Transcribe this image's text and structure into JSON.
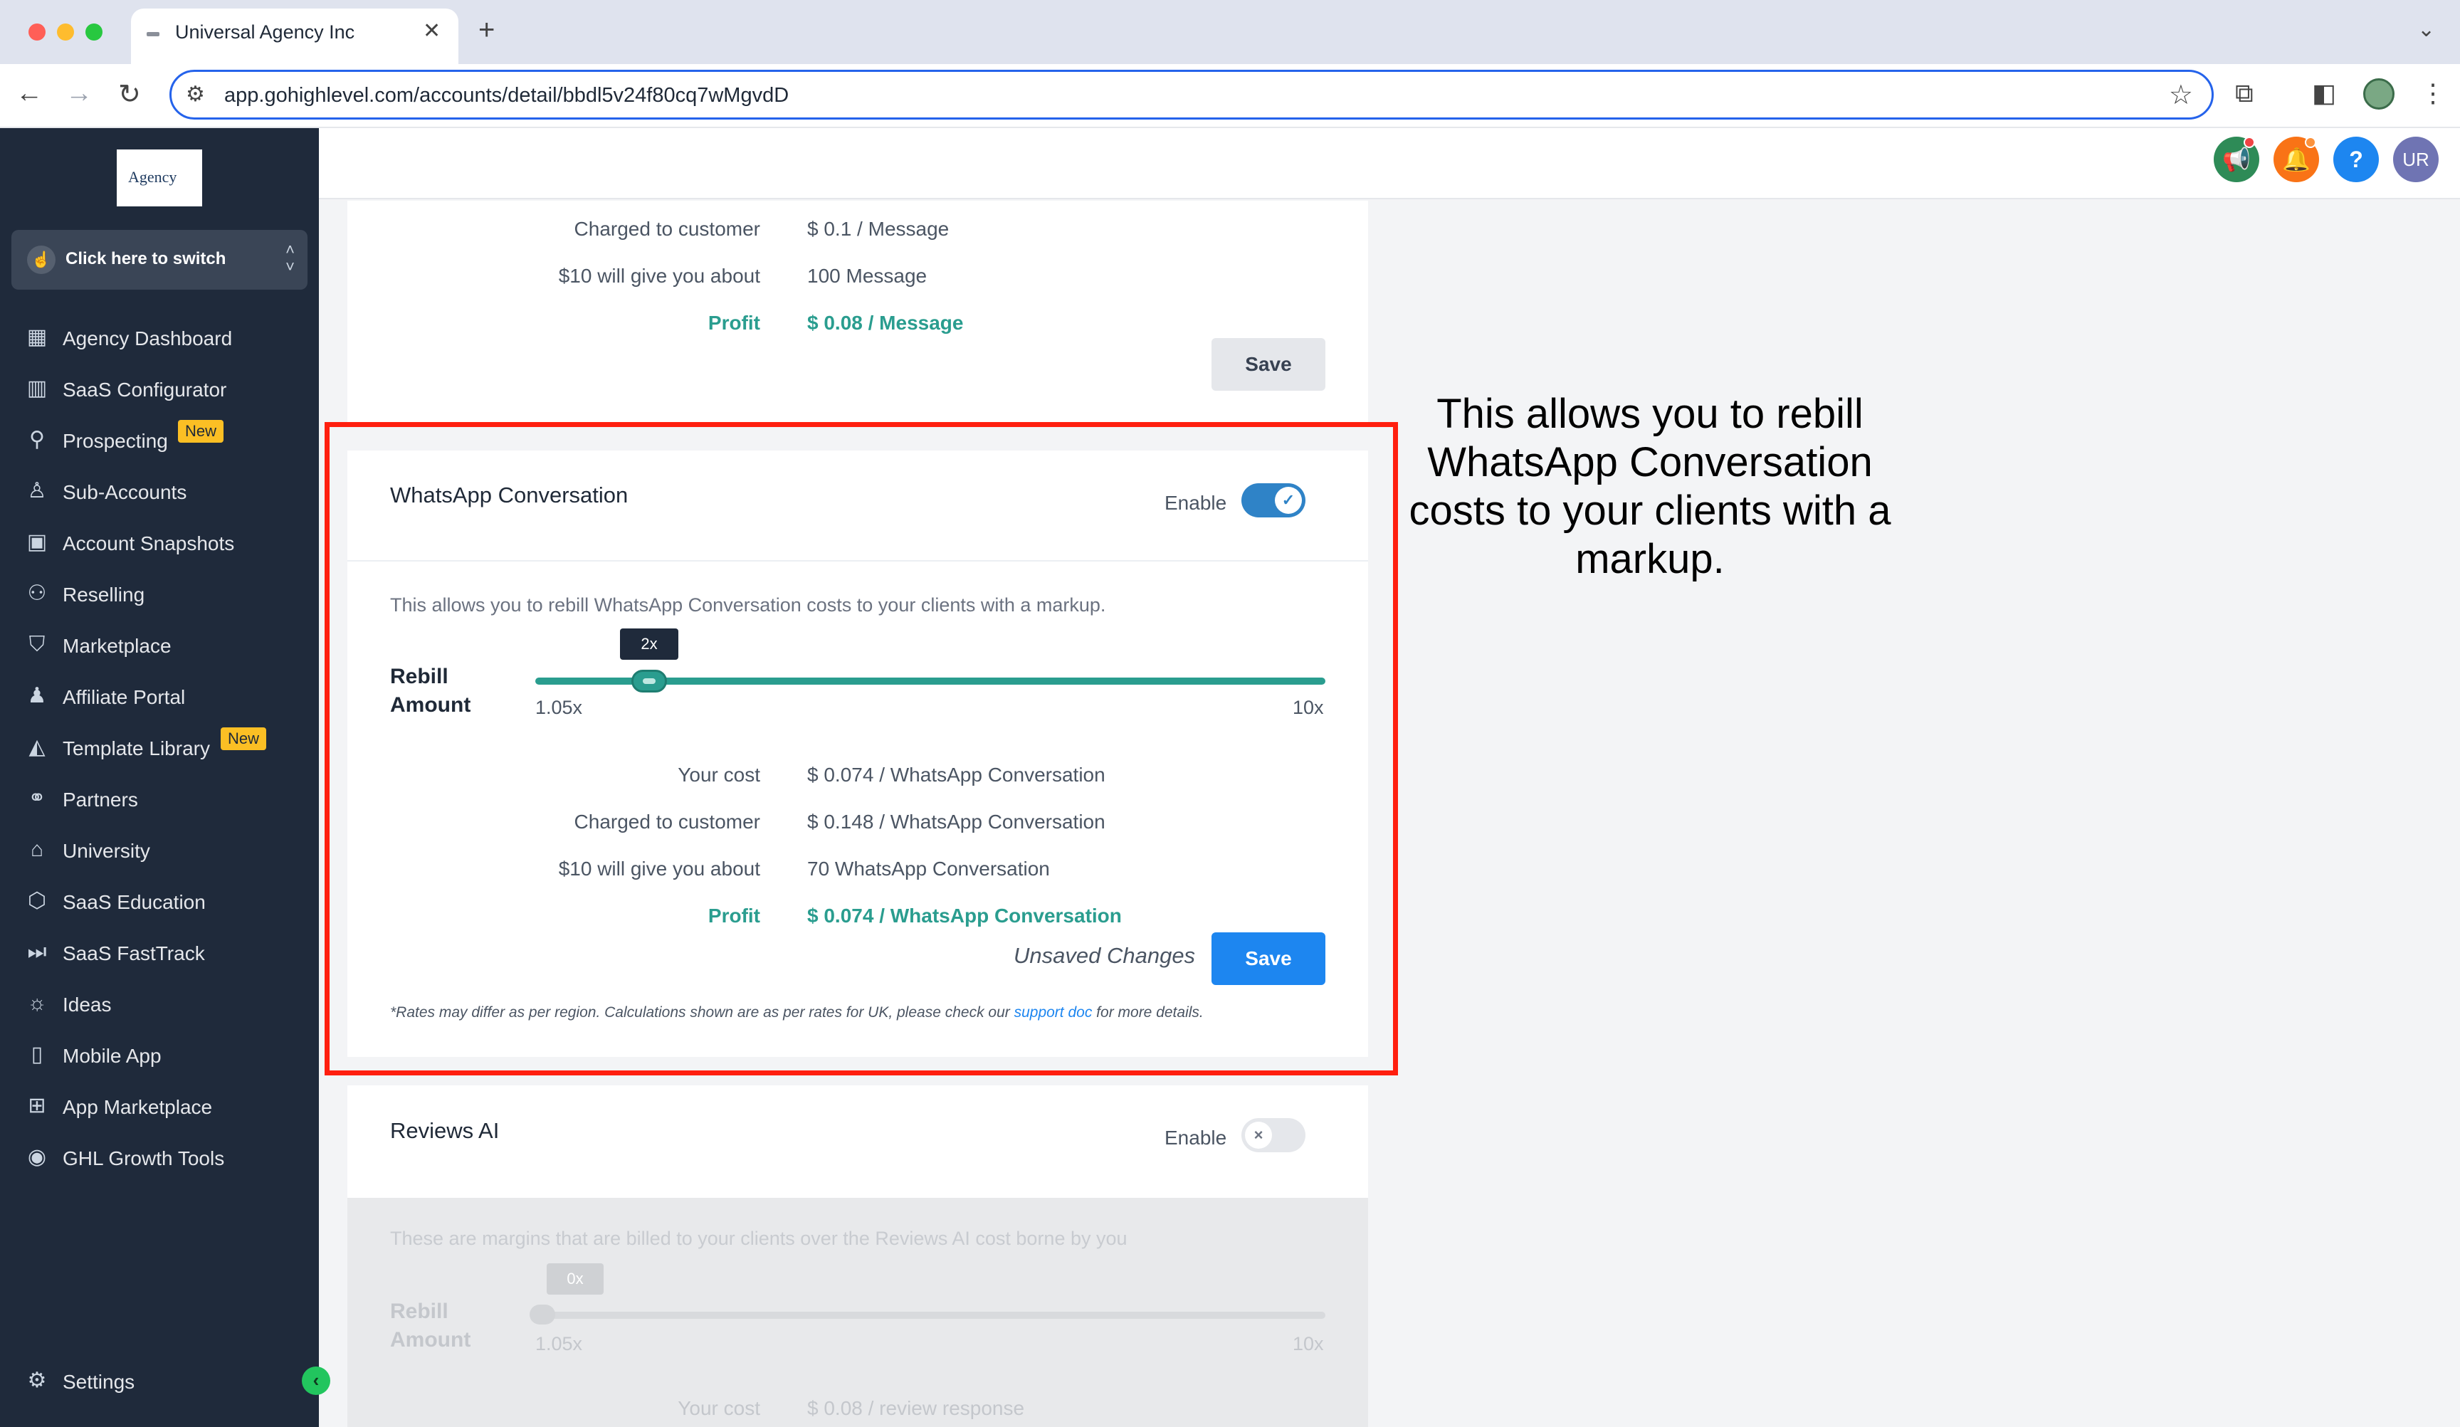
{
  "browser": {
    "tab_title": "Universal Agency Inc",
    "url": "app.gohighlevel.com/accounts/detail/bbdl5v24f80cq7wMgvdD"
  },
  "sidebar": {
    "logo_text": "Agency",
    "switcher_label": "Click here to switch",
    "items": [
      {
        "label": "Agency Dashboard",
        "icon": "dashboard-icon"
      },
      {
        "label": "SaaS Configurator",
        "icon": "chart-icon"
      },
      {
        "label": "Prospecting",
        "icon": "prospecting-icon",
        "badge": "New"
      },
      {
        "label": "Sub-Accounts",
        "icon": "user-icon"
      },
      {
        "label": "Account Snapshots",
        "icon": "snapshot-icon"
      },
      {
        "label": "Reselling",
        "icon": "reselling-icon"
      },
      {
        "label": "Marketplace",
        "icon": "bag-icon"
      },
      {
        "label": "Affiliate Portal",
        "icon": "users-icon"
      },
      {
        "label": "Template Library",
        "icon": "shapes-icon",
        "badge": "New"
      },
      {
        "label": "Partners",
        "icon": "handshake-icon"
      },
      {
        "label": "University",
        "icon": "graduation-cap-icon"
      },
      {
        "label": "SaaS Education",
        "icon": "box-icon"
      },
      {
        "label": "SaaS FastTrack",
        "icon": "fast-forward-icon"
      },
      {
        "label": "Ideas",
        "icon": "lightbulb-icon"
      },
      {
        "label": "Mobile App",
        "icon": "mobile-icon"
      },
      {
        "label": "App Marketplace",
        "icon": "grid-icon"
      },
      {
        "label": "GHL Growth Tools",
        "icon": "growth-icon"
      }
    ],
    "settings_label": "Settings"
  },
  "header": {
    "avatar_initials": "UR"
  },
  "sms_card": {
    "charged_label": "Charged to customer",
    "charged_value": "$ 0.1 / Message",
    "ten_label": "$10 will give you about",
    "ten_value": "100 Message",
    "profit_label": "Profit",
    "profit_value": "$ 0.08 / Message",
    "save_label": "Save"
  },
  "whatsapp_card": {
    "title": "WhatsApp Conversation",
    "enable_label": "Enable",
    "enabled": true,
    "description": "This allows you to rebill WhatsApp Conversation costs to your clients with a markup.",
    "rebill_label_1": "Rebill",
    "rebill_label_2": "Amount",
    "slider_min": "1.05x",
    "slider_max": "10x",
    "slider_value": "2x",
    "slider_fraction": 0.12,
    "your_cost_label": "Your cost",
    "your_cost_value": "$  0.074 / WhatsApp Conversation",
    "charged_label": "Charged to customer",
    "charged_value": "$ 0.148 / WhatsApp Conversation",
    "ten_label": "$10 will give you about",
    "ten_value": "70 WhatsApp Conversation",
    "profit_label": "Profit",
    "profit_value": "$ 0.074 / WhatsApp Conversation",
    "unsaved_label": "Unsaved Changes",
    "save_label": "Save",
    "footnote_pre": "*Rates may differ as per region. Calculations shown are as per rates for UK, please check our ",
    "footnote_link": "support doc",
    "footnote_post": " for more details."
  },
  "reviews_card": {
    "title": "Reviews AI",
    "enable_label": "Enable",
    "enabled": false,
    "description": "These are margins that are billed to your clients over the Reviews AI cost borne by you",
    "rebill_label_1": "Rebill",
    "rebill_label_2": "Amount",
    "slider_min": "1.05x",
    "slider_max": "10x",
    "slider_value": "0x",
    "your_cost_label": "Your cost",
    "your_cost_value": "$  0.08 / review response"
  },
  "annotation": {
    "text": "This allows you to rebill WhatsApp Conversation costs to your clients with a markup."
  },
  "colors": {
    "accent_teal": "#2a9d8f",
    "primary_blue": "#1d86f0",
    "highlight_red": "#ff1f0f",
    "sidebar_bg": "#1f2a3b"
  }
}
